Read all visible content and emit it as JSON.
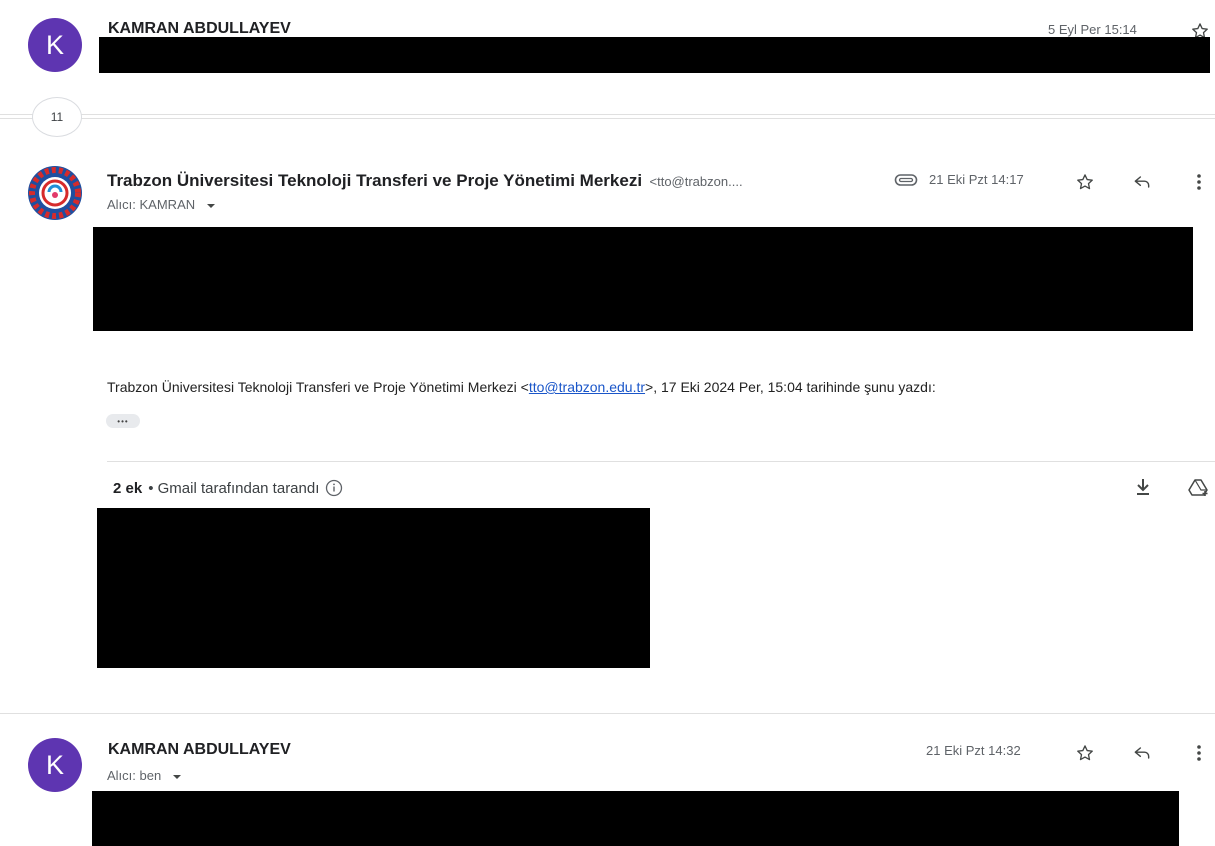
{
  "message1": {
    "avatar_letter": "K",
    "sender": "KAMRAN ABDULLAYEV",
    "date": "5 Eyl Per 15:14"
  },
  "collapsed_count": "11",
  "message2": {
    "sender": "Trabzon Üniversitesi Teknoloji Transferi ve Proje Yönetimi Merkezi",
    "email_truncated": "<tto@trabzon....",
    "date": "21 Eki Pzt 14:17",
    "recipient": "Alıcı: KAMRAN",
    "quote": {
      "prefix": "Trabzon Üniversitesi Teknoloji Transferi ve Proje Yönetimi Merkezi <",
      "link": "tto@trabzon.edu.tr",
      "suffix": ">, 17 Eki 2024 Per, 15:04 tarihinde şunu yazdı:"
    },
    "ellipsis": "•••",
    "attachments": {
      "count_label": "2 ek",
      "scan_label": " • Gmail tarafından tarandı"
    }
  },
  "message3": {
    "avatar_letter": "K",
    "sender": "KAMRAN ABDULLAYEV",
    "date": "21 Eki Pzt 14:32",
    "recipient": "Alıcı: ben"
  },
  "colors": {
    "avatar": "#5e35b1",
    "link": "#1a56c9",
    "redaction": "#000000"
  }
}
